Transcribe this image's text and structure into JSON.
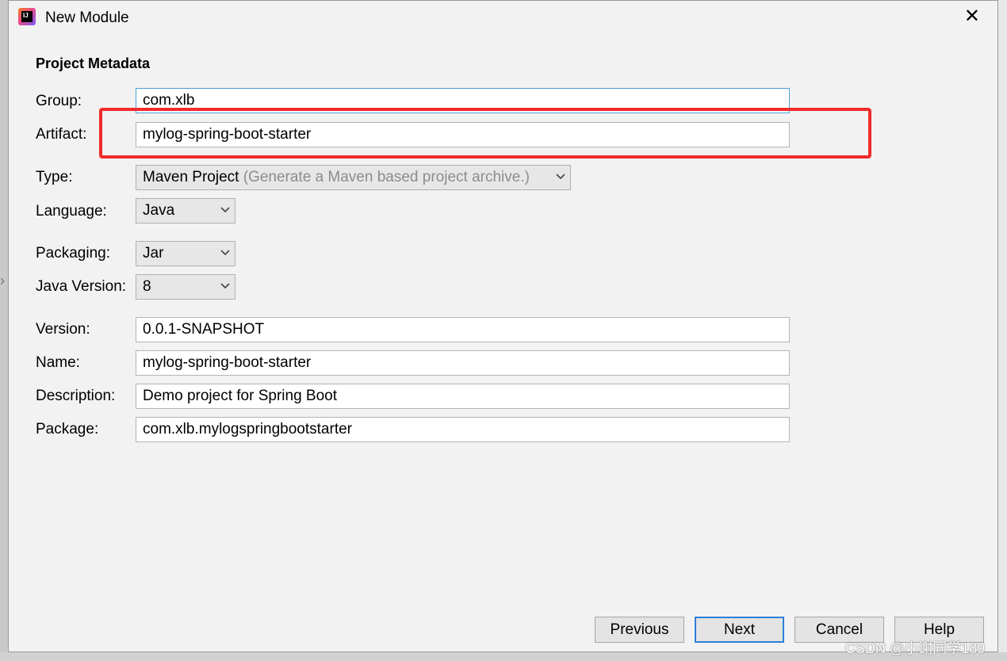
{
  "window": {
    "title": "New Module",
    "icon": "intellij-idea-icon"
  },
  "section_title": "Project Metadata",
  "form": {
    "group": {
      "label": "Group:",
      "value": "com.xlb"
    },
    "artifact": {
      "label": "Artifact:",
      "value": "mylog-spring-boot-starter"
    },
    "type": {
      "label": "Type:",
      "value": "Maven Project",
      "hint": "(Generate a Maven based project archive.)"
    },
    "language": {
      "label": "Language:",
      "value": "Java"
    },
    "packaging": {
      "label": "Packaging:",
      "value": "Jar"
    },
    "java_version": {
      "label": "Java Version:",
      "value": "8"
    },
    "version": {
      "label": "Version:",
      "value": "0.0.1-SNAPSHOT"
    },
    "name": {
      "label": "Name:",
      "value": "mylog-spring-boot-starter"
    },
    "description": {
      "label": "Description:",
      "value": "Demo project for Spring Boot"
    },
    "package": {
      "label": "Package:",
      "value": "com.xlb.mylogspringbootstarter"
    }
  },
  "buttons": {
    "previous": "Previous",
    "next": "Next",
    "cancel": "Cancel",
    "help": "Help"
  },
  "watermark": "CSDN @小谢同学189",
  "colors": {
    "highlight": "#f02b2b",
    "focus_border": "#4b9fd8",
    "primary_border": "#2d7fd6"
  }
}
